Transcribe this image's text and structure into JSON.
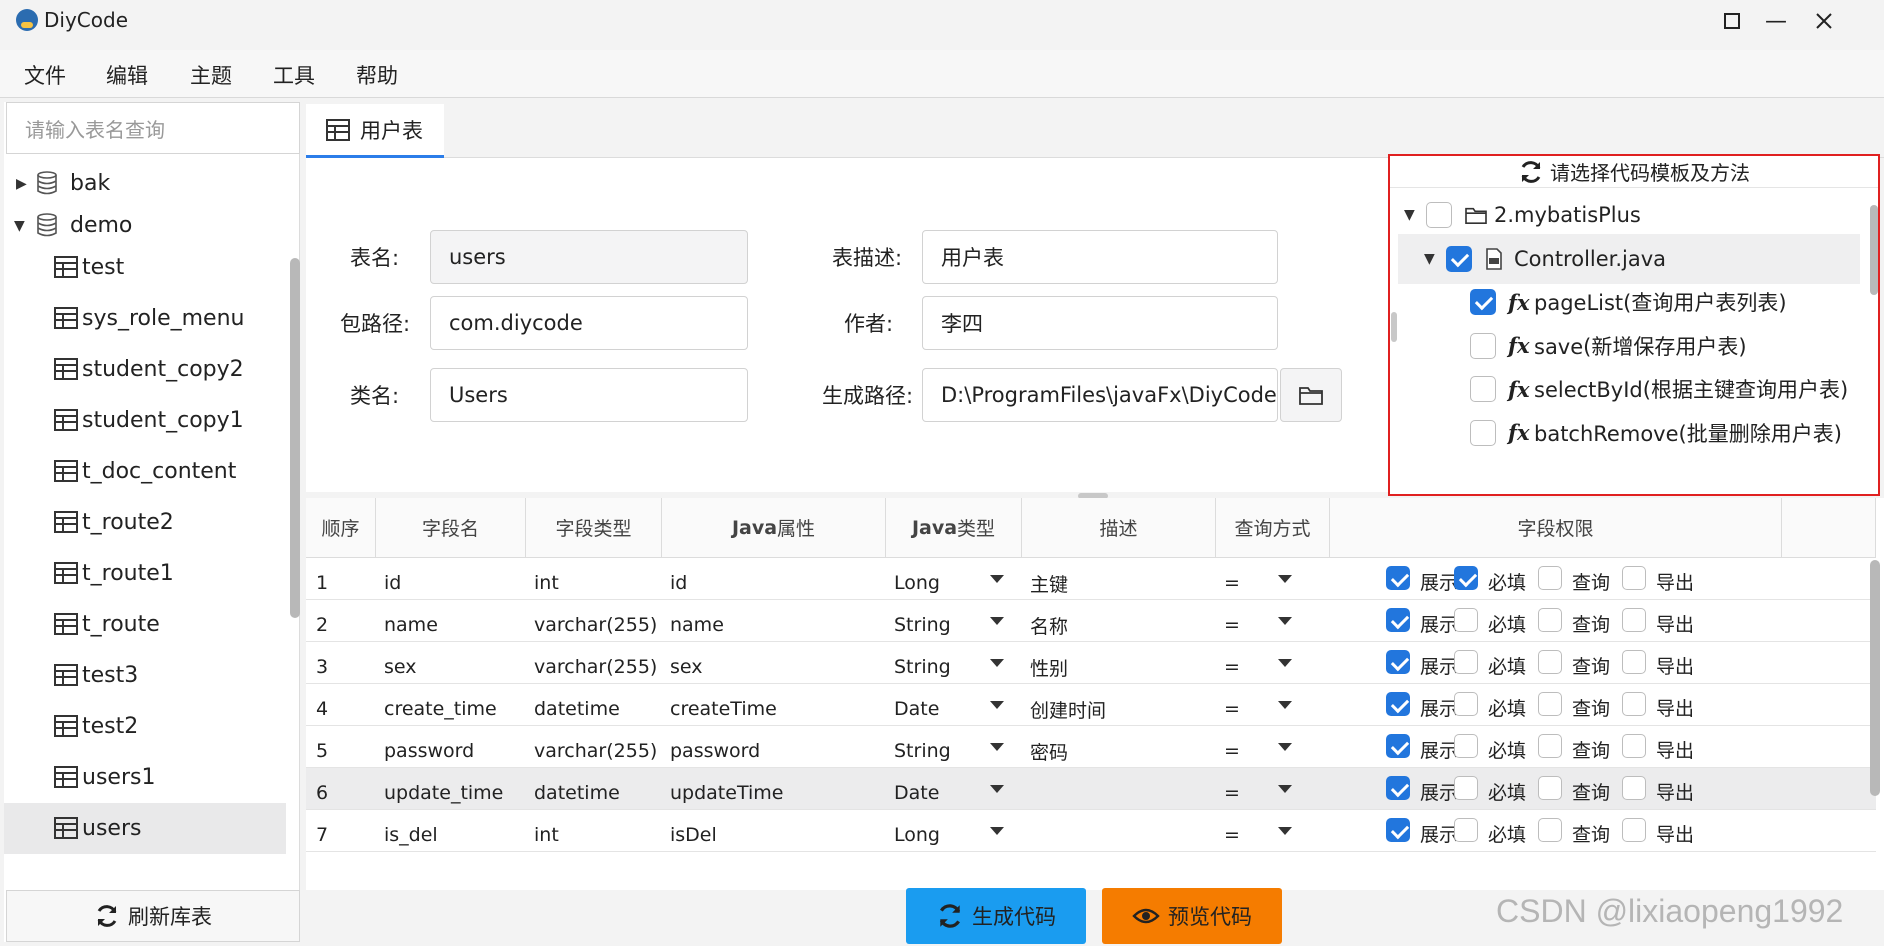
{
  "window": {
    "title": "DiyCode",
    "min_icon": "minimize-icon",
    "max_icon": "maximize-icon",
    "close_icon": "close-icon"
  },
  "menu": [
    "文件",
    "编辑",
    "主题",
    "工具",
    "帮助"
  ],
  "sidebar": {
    "search_placeholder": "请输入表名查询",
    "tree": [
      {
        "label": "bak",
        "type": "database",
        "expanded": false
      },
      {
        "label": "demo",
        "type": "database",
        "expanded": true
      },
      {
        "label": "test",
        "type": "table"
      },
      {
        "label": "sys_role_menu",
        "type": "table"
      },
      {
        "label": "student_copy2",
        "type": "table"
      },
      {
        "label": "student_copy1",
        "type": "table"
      },
      {
        "label": "t_doc_content",
        "type": "table"
      },
      {
        "label": "t_route2",
        "type": "table"
      },
      {
        "label": "t_route1",
        "type": "table"
      },
      {
        "label": "t_route",
        "type": "table"
      },
      {
        "label": "test3",
        "type": "table"
      },
      {
        "label": "test2",
        "type": "table"
      },
      {
        "label": "users1",
        "type": "table"
      },
      {
        "label": "users",
        "type": "table",
        "selected": true
      }
    ],
    "refresh_label": "刷新库表"
  },
  "tab": {
    "label": "用户表"
  },
  "form": {
    "table_name_label": "表名:",
    "table_name": "users",
    "table_desc_label": "表描述:",
    "table_desc": "用户表",
    "package_label": "包路径:",
    "package": "com.diycode",
    "author_label": "作者:",
    "author": "李四",
    "class_label": "类名:",
    "class_name": "Users",
    "output_label": "生成路径:",
    "output_path": "D:\\ProgramFiles\\javaFx\\DiyCode"
  },
  "templates": {
    "header": "请选择代码模板及方法",
    "items": [
      {
        "label": "2.mybatisPlus",
        "level": 0,
        "checked": false,
        "kind": "folder"
      },
      {
        "label": "Controller.java",
        "level": 1,
        "checked": true,
        "kind": "file",
        "highlighted": true
      },
      {
        "label": "pageList(查询用户表列表)",
        "level": 2,
        "checked": true,
        "kind": "method"
      },
      {
        "label": "save(新增保存用户表)",
        "level": 2,
        "checked": false,
        "kind": "method"
      },
      {
        "label": "selectById(根据主键查询用户表)",
        "level": 2,
        "checked": false,
        "kind": "method"
      },
      {
        "label": "batchRemove(批量删除用户表)",
        "level": 2,
        "checked": false,
        "kind": "method"
      }
    ]
  },
  "grid": {
    "headers": {
      "order": "顺序",
      "field": "字段名",
      "ftype": "字段类型",
      "jprop_b": "Java",
      "jprop": "属性",
      "jtype_b": "Java",
      "jtype": "类型",
      "desc": "描述",
      "query": "查询方式",
      "perm": "字段权限"
    },
    "perm_labels": {
      "show": "展示",
      "required": "必填",
      "query": "查询",
      "export": "导出"
    },
    "rows": [
      {
        "order": "1",
        "field": "id",
        "ftype": "int",
        "jprop": "id",
        "jtype": "Long",
        "desc": "主键",
        "query": "=",
        "show": true,
        "required": true,
        "q": false,
        "export": false
      },
      {
        "order": "2",
        "field": "name",
        "ftype": "varchar(255)",
        "jprop": "name",
        "jtype": "String",
        "desc": "名称",
        "query": "=",
        "show": true,
        "required": false,
        "q": false,
        "export": false
      },
      {
        "order": "3",
        "field": "sex",
        "ftype": "varchar(255)",
        "jprop": "sex",
        "jtype": "String",
        "desc": "性别",
        "query": "=",
        "show": true,
        "required": false,
        "q": false,
        "export": false
      },
      {
        "order": "4",
        "field": "create_time",
        "ftype": "datetime",
        "jprop": "createTime",
        "jtype": "Date",
        "desc": "创建时间",
        "query": "=",
        "show": true,
        "required": false,
        "q": false,
        "export": false
      },
      {
        "order": "5",
        "field": "password",
        "ftype": "varchar(255)",
        "jprop": "password",
        "jtype": "String",
        "desc": "密码",
        "query": "=",
        "show": true,
        "required": false,
        "q": false,
        "export": false
      },
      {
        "order": "6",
        "field": "update_time",
        "ftype": "datetime",
        "jprop": "updateTime",
        "jtype": "Date",
        "desc": "",
        "query": "=",
        "show": true,
        "required": false,
        "q": false,
        "export": false,
        "selected": true
      },
      {
        "order": "7",
        "field": "is_del",
        "ftype": "int",
        "jprop": "isDel",
        "jtype": "Long",
        "desc": "",
        "query": "=",
        "show": true,
        "required": false,
        "q": false,
        "export": false
      }
    ]
  },
  "actions": {
    "generate": "生成代码",
    "generate_color": "#1a9cf0",
    "preview": "预览代码",
    "preview_color": "#f57c00"
  },
  "watermark": "CSDN @lixiaopeng1992"
}
